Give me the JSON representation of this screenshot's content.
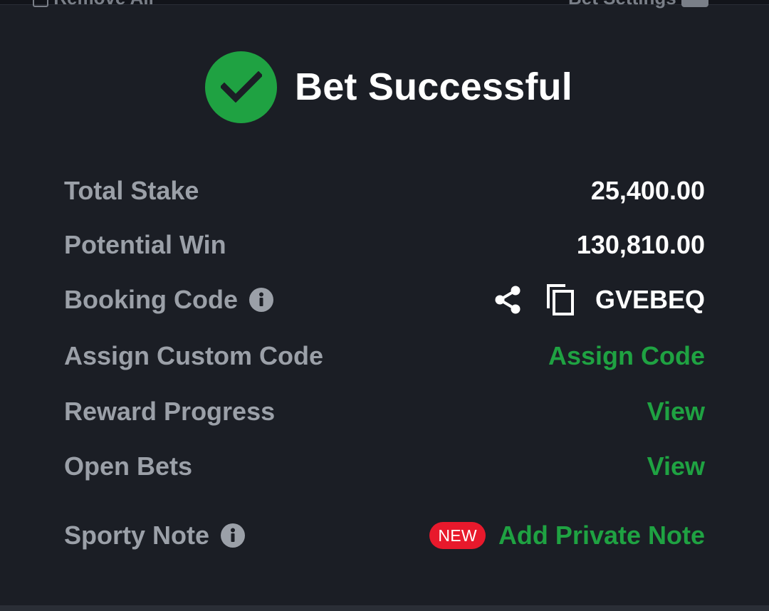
{
  "top_bar": {
    "left_label": "Remove All",
    "right_label": "Bet Settings"
  },
  "header": {
    "title": "Bet Successful",
    "icon": "check-circle-icon",
    "icon_color": "#1fa242"
  },
  "rows": {
    "total_stake": {
      "label": "Total Stake",
      "value": "25,400.00"
    },
    "potential_win": {
      "label": "Potential Win",
      "value": "130,810.00"
    },
    "booking_code": {
      "label": "Booking Code",
      "value": "GVEBEQ"
    },
    "assign_custom_code": {
      "label": "Assign Custom Code",
      "action": "Assign Code"
    },
    "reward_progress": {
      "label": "Reward Progress",
      "action": "View"
    },
    "open_bets": {
      "label": "Open Bets",
      "action": "View"
    },
    "sporty_note": {
      "label": "Sporty Note",
      "badge": "NEW",
      "action": "Add Private Note"
    }
  },
  "colors": {
    "background": "#1b1e25",
    "accent_green": "#1fa242",
    "badge_red": "#e8192c",
    "label_gray": "#9ba0a8"
  }
}
